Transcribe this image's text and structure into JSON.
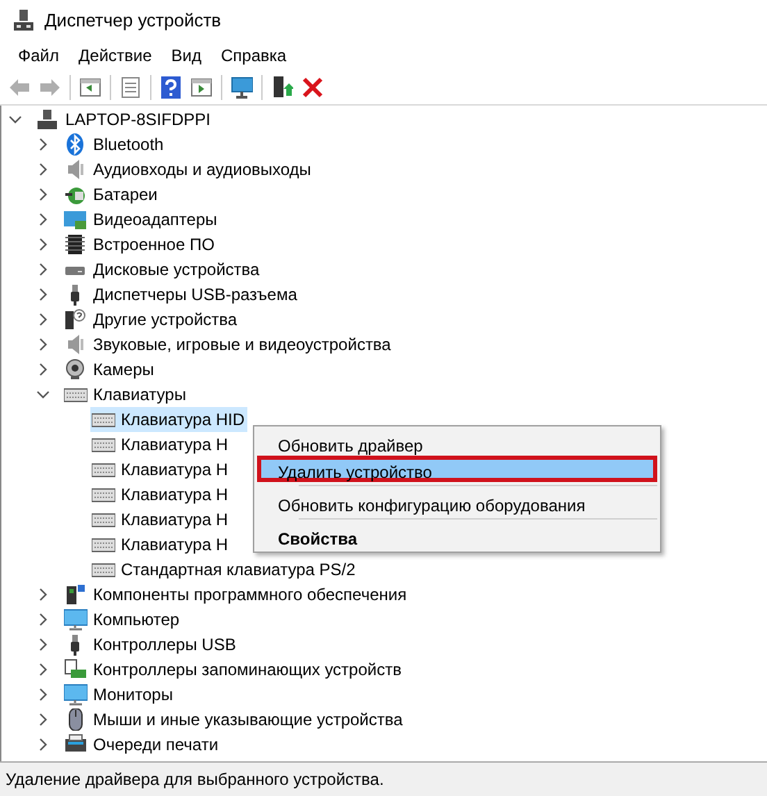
{
  "window": {
    "title": "Диспетчер устройств"
  },
  "menu": [
    "Файл",
    "Действие",
    "Вид",
    "Справка"
  ],
  "toolbar": [
    {
      "kind": "back",
      "disabled": true
    },
    {
      "kind": "forward",
      "disabled": true
    },
    {
      "kind": "sep"
    },
    {
      "kind": "panel",
      "disabled": false
    },
    {
      "kind": "sep"
    },
    {
      "kind": "list",
      "disabled": false
    },
    {
      "kind": "sep"
    },
    {
      "kind": "help",
      "disabled": false
    },
    {
      "kind": "run",
      "disabled": false
    },
    {
      "kind": "sep"
    },
    {
      "kind": "scan",
      "disabled": false
    },
    {
      "kind": "sep"
    },
    {
      "kind": "update",
      "disabled": false
    },
    {
      "kind": "remove",
      "disabled": false
    }
  ],
  "tree": {
    "label": "LAPTOP-8SIFDPPI",
    "kind": "computer",
    "expanded": true,
    "children": [
      {
        "label": "Bluetooth",
        "kind": "bluetooth",
        "expanded": false
      },
      {
        "label": "Аудиовходы и аудиовыходы",
        "kind": "speaker",
        "expanded": false
      },
      {
        "label": "Батареи",
        "kind": "battery",
        "expanded": false
      },
      {
        "label": "Видеоадаптеры",
        "kind": "display",
        "expanded": false
      },
      {
        "label": "Встроенное ПО",
        "kind": "chip",
        "expanded": false
      },
      {
        "label": "Дисковые устройства",
        "kind": "disk",
        "expanded": false
      },
      {
        "label": "Диспетчеры USB-разъема",
        "kind": "usb",
        "expanded": false
      },
      {
        "label": "Другие устройства",
        "kind": "unknown",
        "expanded": false
      },
      {
        "label": "Звуковые, игровые и видеоустройства",
        "kind": "speaker",
        "expanded": false
      },
      {
        "label": "Камеры",
        "kind": "camera",
        "expanded": false
      },
      {
        "label": "Клавиатуры",
        "kind": "keyboard",
        "expanded": true,
        "children": [
          {
            "label": "Клавиатура HID",
            "kind": "keyboard",
            "selected": true
          },
          {
            "label": "Клавиатура H",
            "kind": "keyboard",
            "selected": false
          },
          {
            "label": "Клавиатура H",
            "kind": "keyboard",
            "selected": false
          },
          {
            "label": "Клавиатура H",
            "kind": "keyboard",
            "selected": false
          },
          {
            "label": "Клавиатура H",
            "kind": "keyboard",
            "selected": false
          },
          {
            "label": "Клавиатура H",
            "kind": "keyboard",
            "selected": false
          },
          {
            "label": "Стандартная клавиатура PS/2",
            "kind": "keyboard",
            "selected": false
          }
        ]
      },
      {
        "label": "Компоненты программного обеспечения",
        "kind": "component",
        "expanded": false
      },
      {
        "label": "Компьютер",
        "kind": "monitor",
        "expanded": false
      },
      {
        "label": "Контроллеры USB",
        "kind": "usb",
        "expanded": false
      },
      {
        "label": "Контроллеры запоминающих устройств",
        "kind": "storage",
        "expanded": false
      },
      {
        "label": "Мониторы",
        "kind": "monitor",
        "expanded": false
      },
      {
        "label": "Мыши и иные указывающие устройства",
        "kind": "mouse",
        "expanded": false
      },
      {
        "label": "Очереди печати",
        "kind": "printer",
        "expanded": false
      }
    ]
  },
  "context_menu": [
    {
      "kind": "item",
      "label": "Обновить драйвер",
      "selected": false
    },
    {
      "kind": "item",
      "label": "Удалить устройство",
      "selected": true
    },
    {
      "kind": "sep"
    },
    {
      "kind": "item",
      "label": "Обновить конфигурацию оборудования",
      "selected": false
    },
    {
      "kind": "sep"
    },
    {
      "kind": "bold",
      "label": "Свойства",
      "selected": false
    }
  ],
  "status_bar": "Удаление драйвера для выбранного устройства."
}
